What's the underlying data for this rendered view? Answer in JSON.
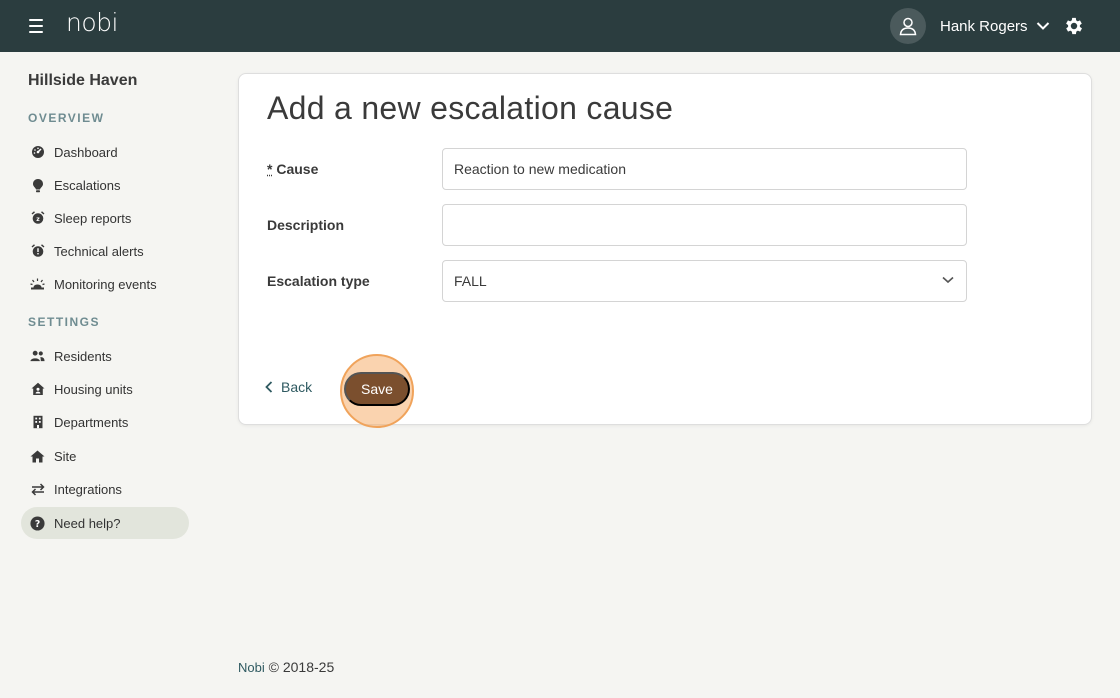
{
  "app": {
    "logo": "nobi",
    "user_name": "Hank Rogers"
  },
  "sidebar": {
    "site_name": "Hillside Haven",
    "overview_label": "OVERVIEW",
    "settings_label": "SETTINGS",
    "overview_items": [
      {
        "label": "Dashboard",
        "icon": "dashboard-icon"
      },
      {
        "label": "Escalations",
        "icon": "escalations-icon"
      },
      {
        "label": "Sleep reports",
        "icon": "sleep-reports-icon"
      },
      {
        "label": "Technical alerts",
        "icon": "technical-alerts-icon"
      },
      {
        "label": "Monitoring events",
        "icon": "monitoring-events-icon"
      }
    ],
    "settings_items": [
      {
        "label": "Residents",
        "icon": "residents-icon"
      },
      {
        "label": "Housing units",
        "icon": "housing-units-icon"
      },
      {
        "label": "Departments",
        "icon": "departments-icon"
      },
      {
        "label": "Site",
        "icon": "site-icon"
      },
      {
        "label": "Integrations",
        "icon": "integrations-icon"
      },
      {
        "label": "Need help?",
        "icon": "help-icon"
      }
    ]
  },
  "form": {
    "title": "Add a new escalation cause",
    "cause_required_mark": "*",
    "cause_label": "Cause",
    "cause_value": "Reaction to new medication",
    "description_label": "Description",
    "description_value": "",
    "escalation_type_label": "Escalation type",
    "escalation_type_value": "FALL",
    "back_label": "Back",
    "save_label": "Save"
  },
  "footer": {
    "brand": "Nobi",
    "copyright": "© 2018-25"
  },
  "colors": {
    "topbar": "#2b3d3f",
    "save_button": "#7b4f2e",
    "highlight": "#f0a35b",
    "link": "#2f5a61"
  }
}
